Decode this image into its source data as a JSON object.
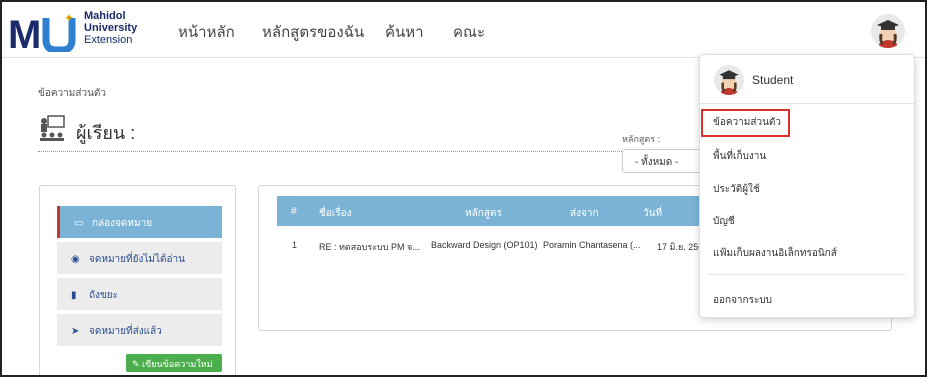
{
  "header": {
    "logo_line1": "Mahidol",
    "logo_line2": "University",
    "logo_line3": "Extension",
    "nav": [
      "หน้าหลัก",
      "หลักสูตรของฉัน",
      "ค้นหา",
      "คณะ"
    ]
  },
  "page": {
    "breadcrumb": "ข้อความส่วนตัว",
    "learner_label": "ผู้เรียน :",
    "course_filter_label": "หลักสูตร :",
    "course_filter_value": "- ทั้งหมด -"
  },
  "menu": {
    "items": [
      "กล่องจดหมาย",
      "จดหมายที่ยังไม่ได้อ่าน",
      "ถังขยะ",
      "จดหมายที่ส่งแล้ว"
    ],
    "new_message": "เขียนข้อความใหม่"
  },
  "table": {
    "headers": [
      "#",
      "ชื่อเรื่อง",
      "หลักสูตร",
      "ส่งจาก",
      "วันที่"
    ],
    "rows": [
      [
        "1",
        "RE : ทดสอบระบบ PM จ...",
        "Backward Design (OP101)",
        "Poramin Chantasena (...",
        "17 มิ.ย. 256"
      ]
    ]
  },
  "dropdown": {
    "user_name": "Student",
    "items": [
      "ข้อความส่วนตัว",
      "พื้นที่เก็บงาน",
      "ประวัติผู้ใช้",
      "บัญชี",
      "แฟ้มเก็บผลงานอิเล็กทรอนิกส์"
    ],
    "logout": "ออกจากระบบ"
  },
  "colors": {
    "brand_blue": "#1b2a6b",
    "table_header": "#7bb3d6",
    "highlight_red": "#d9302c",
    "new_msg_green": "#4cae4c"
  },
  "icons": [
    "logo-mark",
    "student-avatar-icon",
    "classroom-icon",
    "inbox-icon",
    "eye-slash-icon",
    "trash-icon",
    "send-icon",
    "edit-icon"
  ]
}
